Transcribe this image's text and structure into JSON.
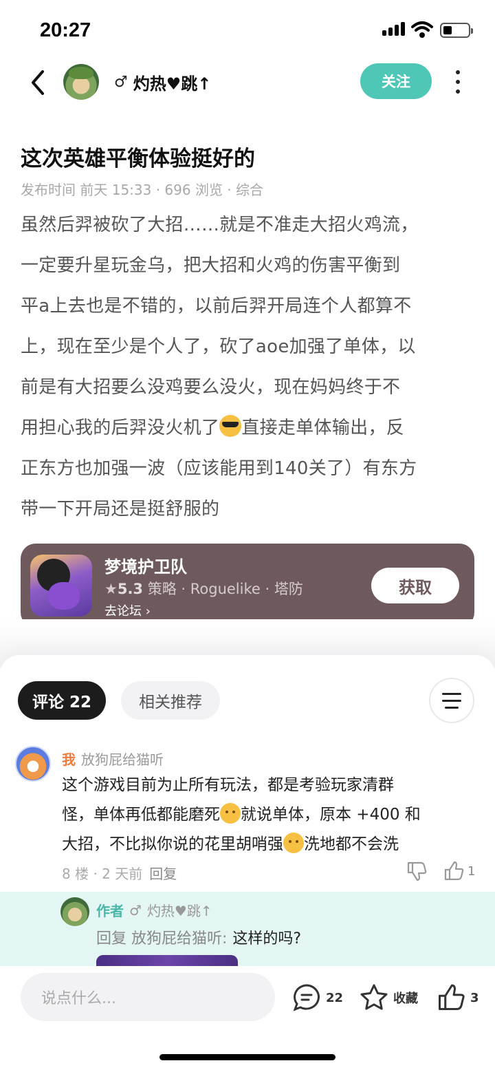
{
  "status": {
    "time": "20:27"
  },
  "nav": {
    "author_name": "灼热♥跳↑",
    "follow": "关注",
    "gender": "♂"
  },
  "post": {
    "title": "这次英雄平衡体验挺好的",
    "meta": "发布时间 前天 15:33 · 696 浏览 · 综合",
    "lines": [
      "虽然后羿被砍了大招……就是不准走大招火鸡流，",
      "一定要升星玩金乌，把大招和火鸡的伤害平衡到",
      "平a上去也是不错的，以前后羿开局连个人都算不",
      "上，现在至少是个人了，砍了aoe加强了单体，以",
      "前是有大招要么没鸡要么没火，现在妈妈终于不",
      "用担心我的后羿没火机了",
      "直接走单体输出，反",
      "正东方也加强一波（应该能用到140关了）有东方",
      "带一下开局还是挺舒服的"
    ]
  },
  "game": {
    "name": "梦境护卫队",
    "score": "5.3",
    "tags": "策略 · Roguelike · 塔防",
    "forum": "去论坛",
    "get": "获取"
  },
  "comments_tabs": {
    "comments": "评论 22",
    "related": "相关推荐"
  },
  "comment": {
    "me": "我",
    "user": "放狗屁给猫听",
    "line1": "这个游戏目前为止所有玩法，都是考验玩家清群",
    "line2a": "怪，单体再低都能磨死",
    "line2b": "就说单体，原本 +400 和",
    "line3a": "大招，不比拟你说的花里胡哨强",
    "line3b": "洗地都不会洗",
    "floor": "8 楼 · 2 天前",
    "reply": "回复",
    "likes": "1"
  },
  "reply": {
    "author_tag": "作者",
    "gender": "♂",
    "name": "灼热♥跳↑",
    "prefix": "回复 放狗屁给猫听:",
    "text": "这样的吗?"
  },
  "bottom": {
    "placeholder": "说点什么...",
    "comments": "22",
    "favorite": "收藏",
    "likes": "3"
  }
}
